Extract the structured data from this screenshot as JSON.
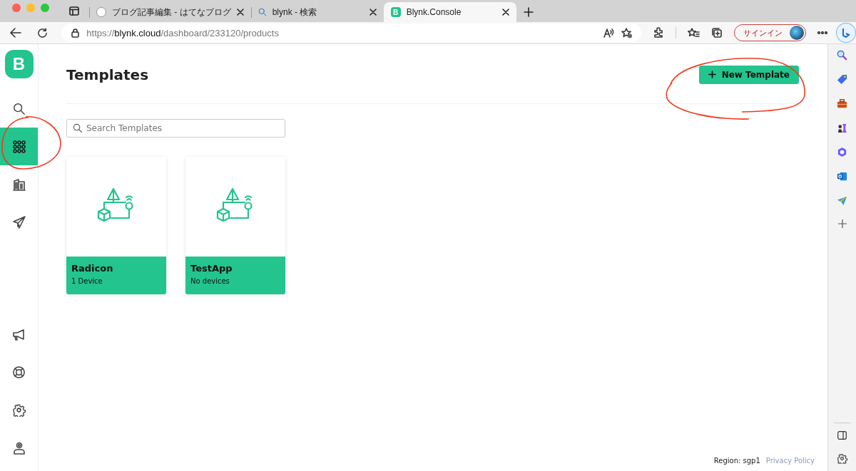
{
  "browser": {
    "tabs": [
      {
        "kind": "hatena",
        "title": "ブログ記事編集 - はてなブログ",
        "selected": false
      },
      {
        "kind": "search",
        "title": "blynk - 検索",
        "selected": false
      },
      {
        "kind": "blynk",
        "favicon_letter": "B",
        "title": "Blynk.Console",
        "selected": true
      }
    ],
    "url": {
      "scheme": "https://",
      "host": "blynk.cloud",
      "path": "/dashboard/233120/products"
    },
    "signin": "サインイン"
  },
  "nav": {
    "logo": "B",
    "items": [
      {
        "kind": "search",
        "selected": false
      },
      {
        "kind": "templates",
        "selected": true
      },
      {
        "kind": "organizations",
        "selected": false
      },
      {
        "kind": "send",
        "selected": false
      }
    ],
    "bottom_items": [
      {
        "kind": "announcements",
        "selected": false
      },
      {
        "kind": "help",
        "selected": false
      },
      {
        "kind": "settings",
        "selected": false
      },
      {
        "kind": "user",
        "selected": false
      }
    ]
  },
  "page": {
    "title": "Templates",
    "new_button": "New Template",
    "search": {
      "placeholder": "Search Templates"
    },
    "templates": [
      {
        "name": "Radicon",
        "devices": "1 Device"
      },
      {
        "name": "TestApp",
        "devices": "No devices"
      }
    ]
  },
  "footer": {
    "region": "Region: sgp1",
    "privacy": "Privacy Policy"
  },
  "annotations": [
    {
      "kind": "ellipse"
    },
    {
      "kind": "ellipse"
    }
  ]
}
